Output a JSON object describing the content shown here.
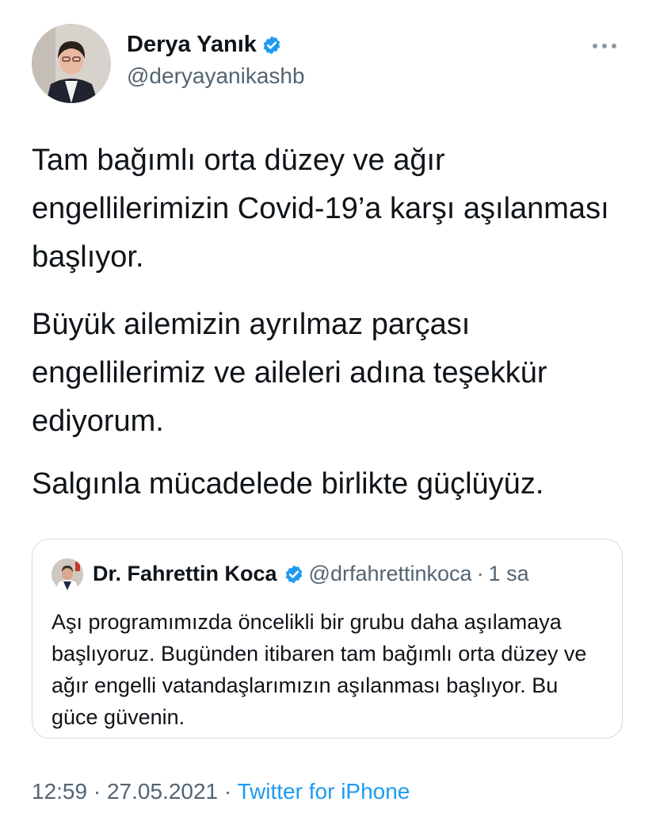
{
  "author": {
    "name": "Derya Yanık",
    "handle": "@deryayanikashb",
    "verified": true
  },
  "tweet": {
    "paragraphs": [
      "Tam bağımlı orta düzey ve ağır engellilerimizin Covid-19’a karşı aşılanması başlıyor.",
      "Büyük ailemizin ayrılmaz parçası engellilerimiz ve aileleri adına teşekkür ediyorum.",
      "Salgınla mücadelede birlikte güçlüyüz."
    ]
  },
  "quoted_tweet": {
    "name": "Dr. Fahrettin Koca",
    "handle": "@drfahrettinkoca",
    "separator": "·",
    "time": "1 sa",
    "verified": true,
    "text": "Aşı programımızda öncelikli bir grubu daha aşılamaya başlıyoruz. Bugünden itibaren tam bağımlı orta düzey ve ağır engelli vatandaşlarımızın aşılanması başlıyor. Bu güce güvenin."
  },
  "meta": {
    "time": "12:59",
    "date": "27.05.2021",
    "separator": "·",
    "source": "Twitter for iPhone"
  },
  "icons": {
    "verified": "verified-badge-icon",
    "more": "more-horizontal-icon"
  },
  "colors": {
    "accent": "#1d9bf0",
    "text_primary": "#0f1419",
    "text_secondary": "#536471",
    "border": "#cfd9de"
  }
}
